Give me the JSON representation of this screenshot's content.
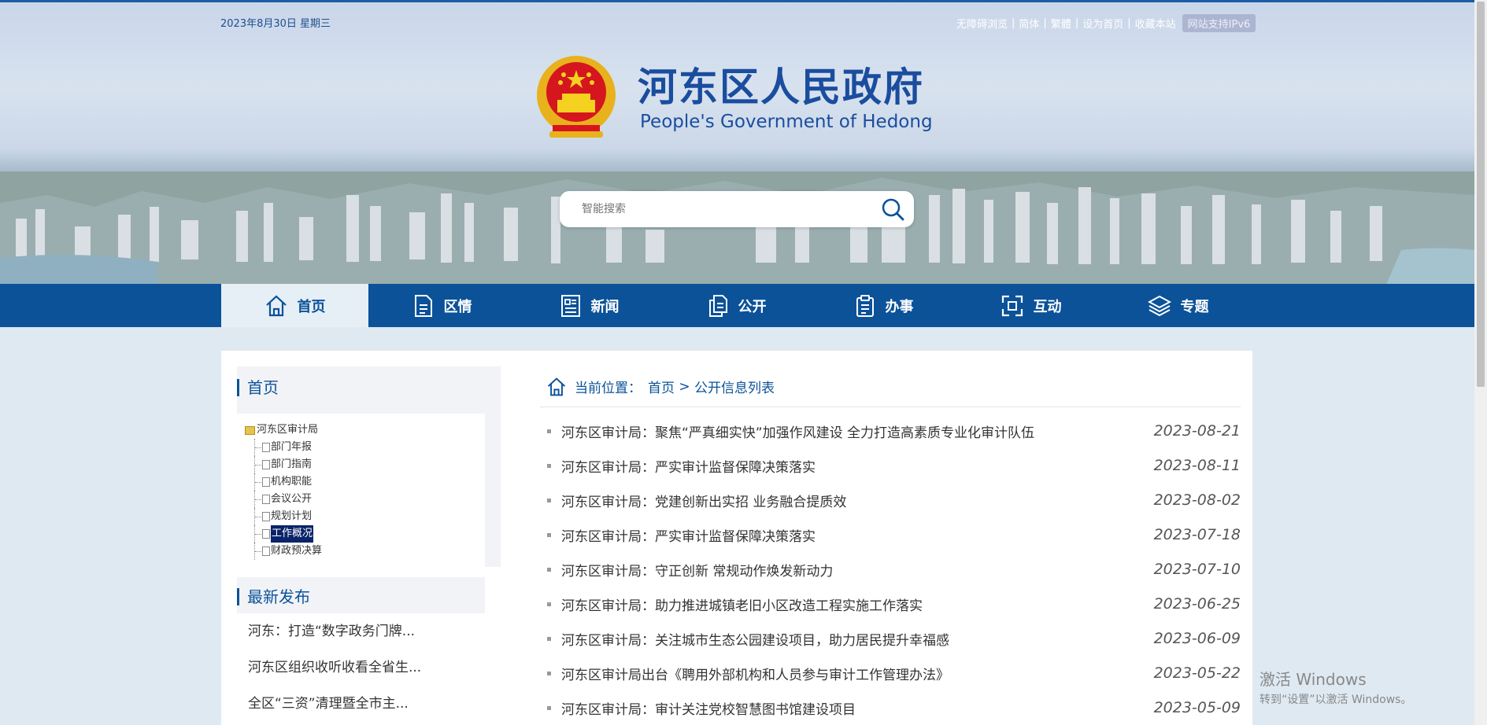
{
  "header": {
    "date": "2023年8月30日  星期三",
    "toplinks": [
      "无障碍浏览",
      "简体",
      "繁體",
      "设为首页",
      "收藏本站"
    ],
    "ipv6": "网站支持IPv6",
    "title_cn": "河东区人民政府",
    "title_en": "People's Government of Hedong",
    "search_placeholder": "智能搜索"
  },
  "nav": {
    "items": [
      {
        "label": "首页",
        "icon": "home-icon"
      },
      {
        "label": "区情",
        "icon": "document-icon"
      },
      {
        "label": "新闻",
        "icon": "news-icon"
      },
      {
        "label": "公开",
        "icon": "copy-icon"
      },
      {
        "label": "办事",
        "icon": "clipboard-icon"
      },
      {
        "label": "互动",
        "icon": "interact-icon"
      },
      {
        "label": "专题",
        "icon": "layers-icon"
      }
    ],
    "active": 0
  },
  "sidebar": {
    "title": "首页",
    "tree_root": "河东区审计局",
    "tree_items": [
      "部门年报",
      "部门指南",
      "机构职能",
      "会议公开",
      "规划计划",
      "工作概况",
      "财政预决算"
    ],
    "selected": "工作概况",
    "latest_title": "最新发布",
    "latest_items": [
      "河东：打造“数字政务门牌...",
      "河东区组织收听收看全省生...",
      "全区“三资”清理暨全市主..."
    ]
  },
  "breadcrumb": {
    "label": "当前位置：",
    "home": "首页",
    "sep": " > ",
    "current": "公开信息列表"
  },
  "list": [
    {
      "title": "河东区审计局：聚焦“严真细实快”加强作风建设 全力打造高素质专业化审计队伍",
      "date": "2023-08-21"
    },
    {
      "title": "河东区审计局：严实审计监督保障决策落实",
      "date": "2023-08-11"
    },
    {
      "title": "河东区审计局：党建创新出实招 业务融合提质效",
      "date": "2023-08-02"
    },
    {
      "title": "河东区审计局：严实审计监督保障决策落实",
      "date": "2023-07-18"
    },
    {
      "title": "河东区审计局：守正创新 常规动作焕发新动力",
      "date": "2023-07-10"
    },
    {
      "title": "河东区审计局：助力推进城镇老旧小区改造工程实施工作落实",
      "date": "2023-06-25"
    },
    {
      "title": "河东区审计局：关注城市生态公园建设项目，助力居民提升幸福感",
      "date": "2023-06-09"
    },
    {
      "title": "河东区审计局出台《聘用外部机构和人员参与审计工作管理办法》",
      "date": "2023-05-22"
    },
    {
      "title": "河东区审计局：审计关注党校智慧图书馆建设项目",
      "date": "2023-05-09"
    }
  ],
  "watermark": {
    "line1": "激活 Windows",
    "line2": "转到“设置”以激活 Windows。"
  }
}
